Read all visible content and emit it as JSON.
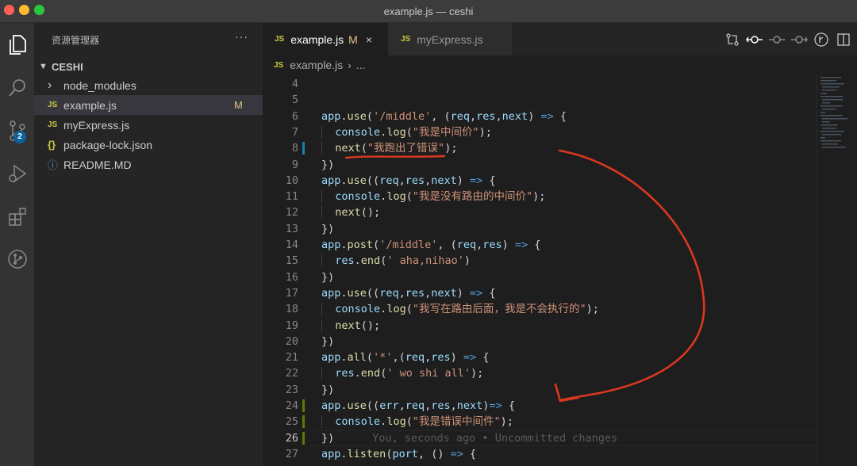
{
  "window": {
    "title": "example.js — ceshi"
  },
  "activity_bar": {
    "items": [
      "explorer-icon",
      "search-icon",
      "source-control-icon",
      "run-debug-icon",
      "extensions-icon",
      "git-graph-icon"
    ],
    "source_control_badge": "2"
  },
  "sidebar": {
    "title": "资源管理器",
    "more": "···",
    "section": "CESHI",
    "items": [
      {
        "icon": "›",
        "label": "node_modules",
        "status": ""
      },
      {
        "icon": "JS",
        "label": "example.js",
        "status": "M"
      },
      {
        "icon": "JS",
        "label": "myExpress.js",
        "status": ""
      },
      {
        "icon": "{}",
        "label": "package-lock.json",
        "status": ""
      },
      {
        "icon": "ⓘ",
        "label": "README.MD",
        "status": ""
      }
    ]
  },
  "tabs": [
    {
      "icon": "JS",
      "label": "example.js",
      "status": "M",
      "close": "×"
    },
    {
      "icon": "JS",
      "label": "myExpress.js"
    }
  ],
  "breadcrumb": {
    "icon": "JS",
    "file": "example.js",
    "sep": "›",
    "rest": "..."
  },
  "colors": {
    "accent_badge": "#0e639c",
    "modified": "#e2c08d",
    "annotation": "#d9381e",
    "gutter_added": "#587c0c",
    "gutter_modified": "#1b81a8"
  },
  "code": {
    "blame": "You, seconds ago • Uncommitted changes",
    "lines": [
      {
        "n": "4",
        "t": []
      },
      {
        "n": "5",
        "t": []
      },
      {
        "n": "6",
        "t": [
          [
            "id",
            "app"
          ],
          [
            "pl",
            "."
          ],
          [
            "fn",
            "use"
          ],
          [
            "pl",
            "("
          ],
          [
            "st",
            "'/middle'"
          ],
          [
            "pl",
            ", ("
          ],
          [
            "id",
            "req"
          ],
          [
            "pl",
            ","
          ],
          [
            "id",
            "res"
          ],
          [
            "pl",
            ","
          ],
          [
            "id",
            "next"
          ],
          [
            "pl",
            ") "
          ],
          [
            "kw",
            "=>"
          ],
          [
            "pl",
            " {"
          ]
        ]
      },
      {
        "n": "7",
        "i": 1,
        "t": [
          [
            "id",
            "console"
          ],
          [
            "pl",
            "."
          ],
          [
            "fn",
            "log"
          ],
          [
            "pl",
            "("
          ],
          [
            "st",
            "\"我是中间价\""
          ],
          [
            "pl",
            ");"
          ]
        ]
      },
      {
        "n": "8",
        "i": 1,
        "g": "mod",
        "t": [
          [
            "fn",
            "next"
          ],
          [
            "pl",
            "("
          ],
          [
            "st",
            "\"我跑出了错误\""
          ],
          [
            "pl",
            ");"
          ]
        ]
      },
      {
        "n": "9",
        "t": [
          [
            "pl",
            "})"
          ]
        ]
      },
      {
        "n": "10",
        "t": [
          [
            "id",
            "app"
          ],
          [
            "pl",
            "."
          ],
          [
            "fn",
            "use"
          ],
          [
            "pl",
            "(("
          ],
          [
            "id",
            "req"
          ],
          [
            "pl",
            ","
          ],
          [
            "id",
            "res"
          ],
          [
            "pl",
            ","
          ],
          [
            "id",
            "next"
          ],
          [
            "pl",
            ") "
          ],
          [
            "kw",
            "=>"
          ],
          [
            "pl",
            " {"
          ]
        ]
      },
      {
        "n": "11",
        "i": 1,
        "t": [
          [
            "id",
            "console"
          ],
          [
            "pl",
            "."
          ],
          [
            "fn",
            "log"
          ],
          [
            "pl",
            "("
          ],
          [
            "st",
            "\"我是没有路由的中间价\""
          ],
          [
            "pl",
            ");"
          ]
        ]
      },
      {
        "n": "12",
        "i": 1,
        "t": [
          [
            "fn",
            "next"
          ],
          [
            "pl",
            "();"
          ]
        ]
      },
      {
        "n": "13",
        "t": [
          [
            "pl",
            "})"
          ]
        ]
      },
      {
        "n": "14",
        "t": [
          [
            "id",
            "app"
          ],
          [
            "pl",
            "."
          ],
          [
            "fn",
            "post"
          ],
          [
            "pl",
            "("
          ],
          [
            "st",
            "'/middle'"
          ],
          [
            "pl",
            ", ("
          ],
          [
            "id",
            "req"
          ],
          [
            "pl",
            ","
          ],
          [
            "id",
            "res"
          ],
          [
            "pl",
            ") "
          ],
          [
            "kw",
            "=>"
          ],
          [
            "pl",
            " {"
          ]
        ]
      },
      {
        "n": "15",
        "i": 1,
        "t": [
          [
            "id",
            "res"
          ],
          [
            "pl",
            "."
          ],
          [
            "fn",
            "end"
          ],
          [
            "pl",
            "("
          ],
          [
            "st",
            "' aha,nihao'"
          ],
          [
            "pl",
            ")"
          ]
        ]
      },
      {
        "n": "16",
        "t": [
          [
            "pl",
            "})"
          ]
        ]
      },
      {
        "n": "17",
        "t": [
          [
            "id",
            "app"
          ],
          [
            "pl",
            "."
          ],
          [
            "fn",
            "use"
          ],
          [
            "pl",
            "(("
          ],
          [
            "id",
            "req"
          ],
          [
            "pl",
            ","
          ],
          [
            "id",
            "res"
          ],
          [
            "pl",
            ","
          ],
          [
            "id",
            "next"
          ],
          [
            "pl",
            ") "
          ],
          [
            "kw",
            "=>"
          ],
          [
            "pl",
            " {"
          ]
        ]
      },
      {
        "n": "18",
        "i": 1,
        "t": [
          [
            "id",
            "console"
          ],
          [
            "pl",
            "."
          ],
          [
            "fn",
            "log"
          ],
          [
            "pl",
            "("
          ],
          [
            "st",
            "\"我写在路由后面，我是不会执行的\""
          ],
          [
            "pl",
            ");"
          ]
        ]
      },
      {
        "n": "19",
        "i": 1,
        "t": [
          [
            "fn",
            "next"
          ],
          [
            "pl",
            "();"
          ]
        ]
      },
      {
        "n": "20",
        "t": [
          [
            "pl",
            "})"
          ]
        ]
      },
      {
        "n": "21",
        "t": [
          [
            "id",
            "app"
          ],
          [
            "pl",
            "."
          ],
          [
            "fn",
            "all"
          ],
          [
            "pl",
            "("
          ],
          [
            "st",
            "'*'"
          ],
          [
            "pl",
            ",("
          ],
          [
            "id",
            "req"
          ],
          [
            "pl",
            ","
          ],
          [
            "id",
            "res"
          ],
          [
            "pl",
            ") "
          ],
          [
            "kw",
            "=>"
          ],
          [
            "pl",
            " {"
          ]
        ]
      },
      {
        "n": "22",
        "i": 1,
        "t": [
          [
            "id",
            "res"
          ],
          [
            "pl",
            "."
          ],
          [
            "fn",
            "end"
          ],
          [
            "pl",
            "("
          ],
          [
            "st",
            "' wo shi all'"
          ],
          [
            "pl",
            ");"
          ]
        ]
      },
      {
        "n": "23",
        "t": [
          [
            "pl",
            "})"
          ]
        ]
      },
      {
        "n": "24",
        "g": "add",
        "t": [
          [
            "id",
            "app"
          ],
          [
            "pl",
            "."
          ],
          [
            "fn",
            "use"
          ],
          [
            "pl",
            "(("
          ],
          [
            "id",
            "err"
          ],
          [
            "pl",
            ","
          ],
          [
            "id",
            "req"
          ],
          [
            "pl",
            ","
          ],
          [
            "id",
            "res"
          ],
          [
            "pl",
            ","
          ],
          [
            "id",
            "next"
          ],
          [
            "pl",
            ")"
          ],
          [
            "kw",
            "=>"
          ],
          [
            "pl",
            " {"
          ]
        ]
      },
      {
        "n": "25",
        "i": 1,
        "g": "add",
        "t": [
          [
            "id",
            "console"
          ],
          [
            "pl",
            "."
          ],
          [
            "fn",
            "log"
          ],
          [
            "pl",
            "("
          ],
          [
            "st",
            "\"我是错误中间件\""
          ],
          [
            "pl",
            ");"
          ]
        ]
      },
      {
        "n": "26",
        "g": "add",
        "cur": true,
        "t": [
          [
            "pl",
            "})"
          ]
        ]
      },
      {
        "n": "27",
        "t": [
          [
            "id",
            "app"
          ],
          [
            "pl",
            "."
          ],
          [
            "fn",
            "listen"
          ],
          [
            "pl",
            "("
          ],
          [
            "id",
            "port"
          ],
          [
            "pl",
            ", () "
          ],
          [
            "kw",
            "=>"
          ],
          [
            "pl",
            " {"
          ]
        ]
      }
    ]
  }
}
